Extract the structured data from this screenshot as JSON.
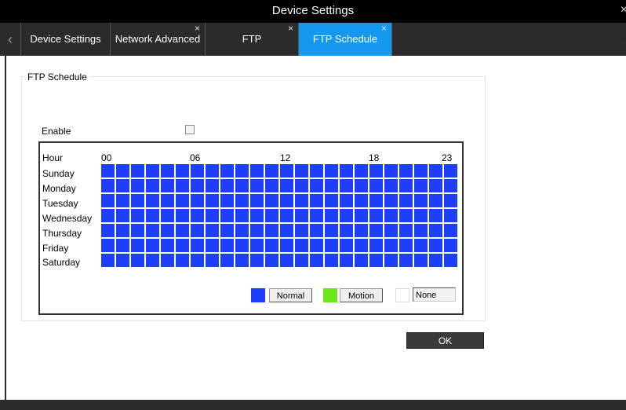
{
  "window": {
    "title": "Device Settings",
    "close_glyph": "×"
  },
  "tabs": [
    {
      "label": "Device Settings",
      "closable": false,
      "active": false
    },
    {
      "label": "Network Advanced",
      "closable": true,
      "active": false
    },
    {
      "label": "FTP",
      "closable": true,
      "active": false
    },
    {
      "label": "FTP Schedule",
      "closable": true,
      "active": true
    }
  ],
  "tab_nav": {
    "left_glyph": "‹",
    "right_glyph": "›"
  },
  "group": {
    "title": "FTP Schedule"
  },
  "enable": {
    "label": "Enable",
    "checked": false
  },
  "schedule": {
    "hour_label": "Hour",
    "hour_ticks": [
      "00",
      "06",
      "12",
      "18",
      "23"
    ],
    "days": [
      "Sunday",
      "Monday",
      "Tuesday",
      "Wednesday",
      "Thursday",
      "Friday",
      "Saturday"
    ],
    "hours_per_day": 24,
    "cell_mode": "normal"
  },
  "legend": {
    "normal": {
      "label": "Normal",
      "color": "#1d3ffb"
    },
    "motion": {
      "label": "Motion",
      "color": "#6ee61c"
    },
    "none": {
      "label": "None",
      "color": "#ffffff"
    }
  },
  "ok_button": {
    "label": "OK"
  },
  "colors": {
    "accent": "#1599f0",
    "titlebar": "#000000",
    "tabbar": "#2b2b2b"
  }
}
